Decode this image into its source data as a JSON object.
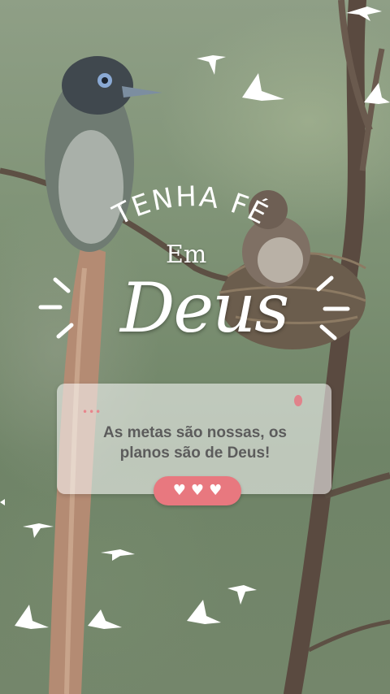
{
  "headline": {
    "line1": "TENHA FÉ",
    "line2": "Em",
    "line3": "Deus"
  },
  "card": {
    "quote": "As metas são nossas, os planos são de Deus!",
    "dots": "•••",
    "reaction_hearts": [
      "♥",
      "♥",
      "♥"
    ]
  },
  "colors": {
    "accent": "#e8787f",
    "text_dark": "#5c5c5c",
    "white": "#ffffff"
  },
  "icons": [
    "bird-silhouette-icon",
    "heart-icon",
    "sparkle-burst-icon"
  ]
}
